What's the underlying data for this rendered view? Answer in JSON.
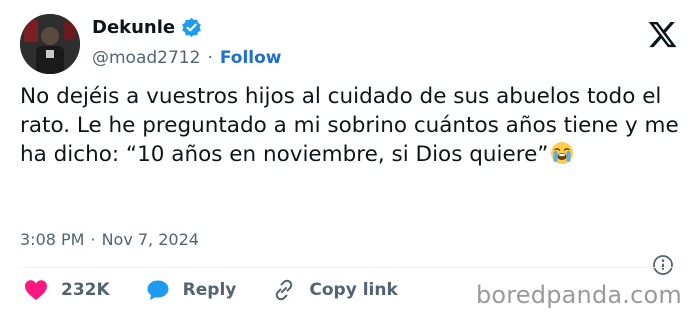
{
  "author": {
    "name": "Dekunle",
    "handle": "@moad2712",
    "separator": "·",
    "follow_label": "Follow"
  },
  "tweet": {
    "text": "No dejéis a vuestros hijos al cuidado de sus abuelos todo el rato. Le he preguntado a mi sobrino cuántos años tiene y me ha dicho: “10 años en noviembre, si Dios quiere”",
    "emoji": "loudly-crying-face",
    "time": "3:08 PM",
    "separator": "·",
    "date": "Nov 7, 2024"
  },
  "actions": {
    "likes": "232K",
    "reply_label": "Reply",
    "copy_link_label": "Copy link"
  },
  "watermark": "boredpanda.com",
  "colors": {
    "accent": "#1d9bf0",
    "follow": "#1d6fd0",
    "like": "#f91880",
    "reply": "#1d9bf0",
    "muted": "#536471"
  }
}
